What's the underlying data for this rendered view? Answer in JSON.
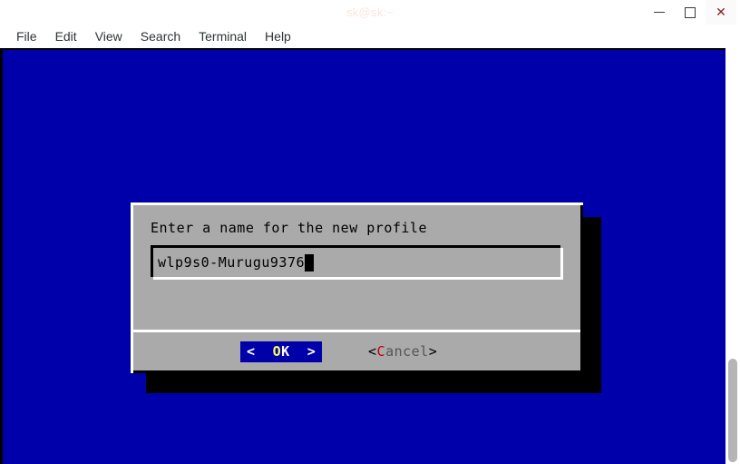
{
  "window": {
    "title": "sk@sk:~",
    "controls": {
      "minimize": "minimize-label",
      "maximize": "maximize-label",
      "close": "✕"
    }
  },
  "menubar": {
    "items": [
      {
        "label": "File"
      },
      {
        "label": "Edit"
      },
      {
        "label": "View"
      },
      {
        "label": "Search"
      },
      {
        "label": "Terminal"
      },
      {
        "label": "Help"
      }
    ]
  },
  "terminal": {
    "background_color": "#0000aa",
    "scrollbar": {
      "thumb_color": "#b5b5b5"
    }
  },
  "dialog": {
    "background_color": "#aaaaaa",
    "prompt": "Enter a name for the new profile",
    "input": {
      "value": "wlp9s0-Murugu9376",
      "placeholder": "",
      "cursor": "block"
    },
    "buttons": {
      "ok": {
        "open_bracket": "<",
        "hotkey": "O",
        "rest": "K",
        "close_bracket": ">",
        "spacer_left": "  ",
        "spacer_right": "  ",
        "selected": true,
        "selected_bg": "#0000aa",
        "hotkey_color": "#ffff55"
      },
      "cancel": {
        "open_bracket": "<",
        "hotkey": "C",
        "rest": "ancel",
        "close_bracket": ">",
        "selected": false,
        "hotkey_color": "#c00000"
      }
    }
  }
}
